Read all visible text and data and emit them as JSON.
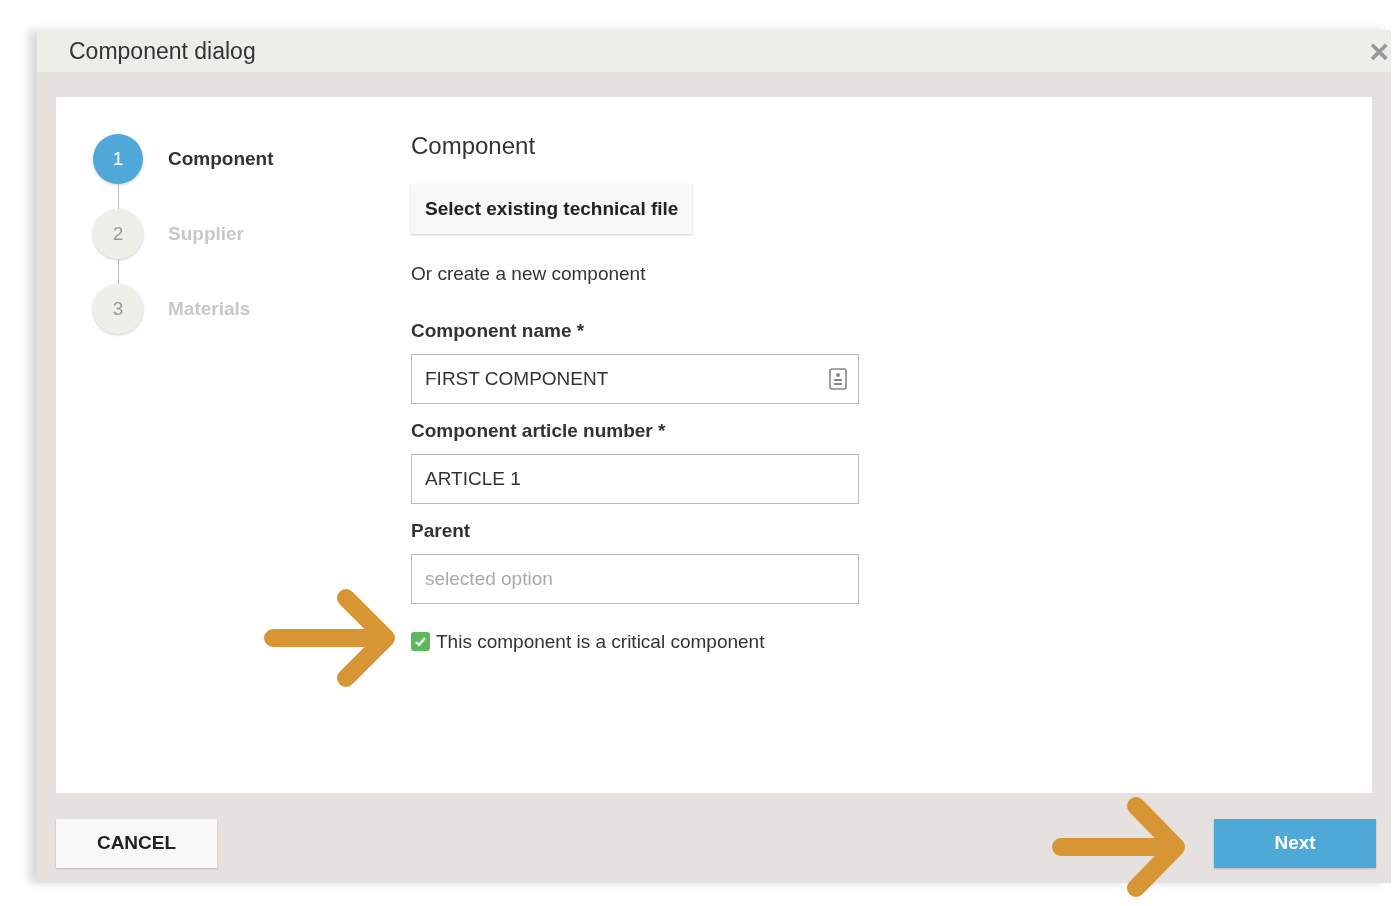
{
  "dialog": {
    "title": "Component dialog",
    "close": "×"
  },
  "steps": [
    {
      "number": "1",
      "label": "Component",
      "selected": true
    },
    {
      "number": "2",
      "label": "Supplier",
      "selected": false
    },
    {
      "number": "3",
      "label": "Materials",
      "selected": false
    }
  ],
  "form": {
    "heading": "Component",
    "select_button": "Select existing technical file",
    "intro": "Or create a new component",
    "fields": [
      {
        "label": "Component name *",
        "value": "FIRST COMPONENT",
        "kind": "contact"
      },
      {
        "label": "Component article number *",
        "value": "ARTICLE 1",
        "kind": "plain"
      },
      {
        "label": "Parent",
        "placeholder": "selected option",
        "kind": "plain"
      }
    ],
    "critical": {
      "label": "This component is a critical component",
      "checked": true
    }
  },
  "footer": {
    "cancel": "CANCEL",
    "next": "Next"
  }
}
